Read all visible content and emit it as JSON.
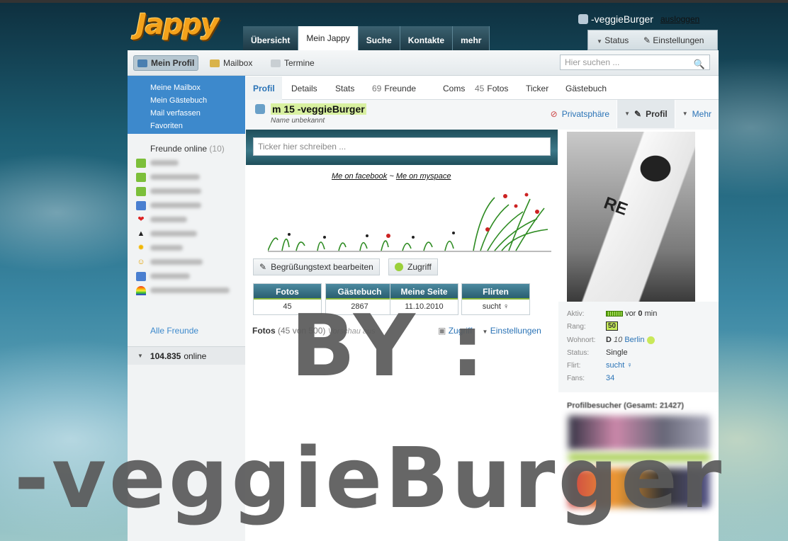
{
  "logo_text": "Jappy",
  "main_tabs": [
    "Übersicht",
    "Mein Jappy",
    "Suche",
    "Kontakte",
    "mehr"
  ],
  "user": {
    "name": "-veggieBurger",
    "logout": "ausloggen"
  },
  "status_bar": {
    "status": "Status",
    "settings": "Einstellungen"
  },
  "subnav": {
    "profile": "Mein Profil",
    "mailbox": "Mailbox",
    "dates": "Termine",
    "search_placeholder": "Hier suchen ..."
  },
  "sidebar": {
    "links": [
      "Meine Mailbox",
      "Mein Gästebuch",
      "Mail verfassen",
      "Favoriten"
    ],
    "friends_title": "Freunde online",
    "friends_count": "(10)",
    "all_friends": "Alle Freunde",
    "online_count": "104.835",
    "online_label": "online"
  },
  "profile_tabs": [
    {
      "n": "",
      "label": "Profil"
    },
    {
      "n": "",
      "label": "Details"
    },
    {
      "n": "",
      "label": "Stats"
    },
    {
      "n": "69",
      "label": "Freunde"
    },
    {
      "n": "",
      "label": "Coms"
    },
    {
      "n": "45",
      "label": "Fotos"
    },
    {
      "n": "",
      "label": "Ticker"
    },
    {
      "n": "",
      "label": "Gästebuch"
    }
  ],
  "profile": {
    "title": "m 15 -veggieBurger",
    "subtitle": "Name unbekannt",
    "privacy": "Privatsphäre",
    "profil_btn": "Profil",
    "more_btn": "Mehr"
  },
  "content": {
    "ticker_placeholder": "Ticker hier schreiben ...",
    "facebook": "Me on facebook",
    "separator": "~",
    "myspace": "Me on myspace",
    "greeting_btn": "Begrüßungstext bearbeiten",
    "access_btn": "Zugriff",
    "stats": [
      {
        "label": "Fotos",
        "value": "45"
      },
      {
        "label": "Gästebuch",
        "value": "2867"
      },
      {
        "label": "Meine Seite",
        "value": "11.10.2010"
      },
      {
        "label": "Flirten",
        "value": "sucht ♀"
      }
    ],
    "fotos_label": "Fotos",
    "fotos_count": "(45 von 500)",
    "fotos_preview": "Vorschau aus",
    "fotos_access": "Zugriff",
    "fotos_settings": "Einstellungen"
  },
  "info": {
    "aktiv_label": "Aktiv:",
    "aktiv_prefix": "vor",
    "aktiv_num": "0",
    "aktiv_unit": "min",
    "rang_label": "Rang:",
    "rang_value": "50",
    "wohnort_label": "Wohnort:",
    "wohnort_country": "D",
    "wohnort_num": "10",
    "wohnort_city": "Berlin",
    "status_label": "Status:",
    "status_value": "Single",
    "flirt_label": "Flirt:",
    "flirt_value": "sucht ♀",
    "fans_label": "Fans:",
    "fans_value": "34"
  },
  "visitors_title": "Profilbesucher (Gesamt: 21427)",
  "watermark": {
    "line1": "BY :",
    "line2": "-veggieBurger"
  }
}
